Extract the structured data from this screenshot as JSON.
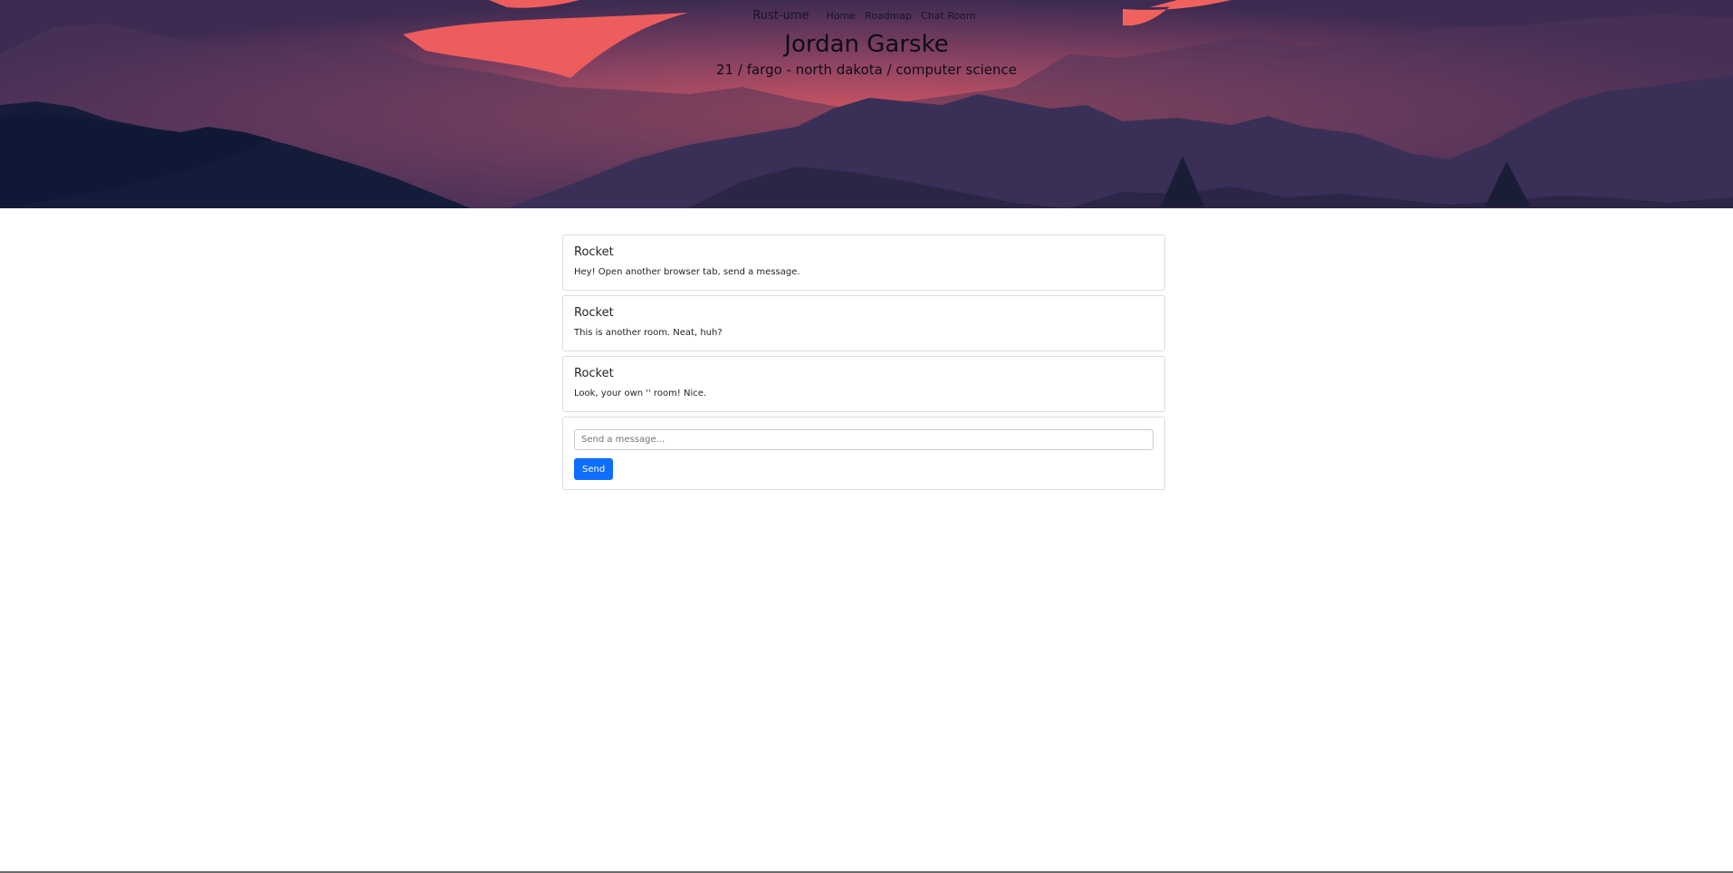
{
  "colors": {
    "sky_top": "#3d2a52",
    "sky_glow": "#c8505c",
    "cloud": "#f0605e",
    "mountain_far": "#4a3358",
    "mountain_mid": "#2f2a4d",
    "mountain_near": "#0f1936",
    "send_button": "#0d6efd"
  },
  "navbar": {
    "brand": "Rust-ume",
    "links": [
      {
        "label": "Home"
      },
      {
        "label": "Roadmap"
      },
      {
        "label": "Chat Room"
      }
    ]
  },
  "hero": {
    "title": "Jordan Garske",
    "subtitle": "21 / fargo - north dakota / computer science"
  },
  "messages": [
    {
      "user": "Rocket",
      "text": "Hey! Open another browser tab, send a message."
    },
    {
      "user": "Rocket",
      "text": "This is another room. Neat, huh?"
    },
    {
      "user": "Rocket",
      "text": "Look, your own '' room! Nice."
    }
  ],
  "composer": {
    "placeholder": "Send a message...",
    "value": "",
    "send_label": "Send"
  }
}
